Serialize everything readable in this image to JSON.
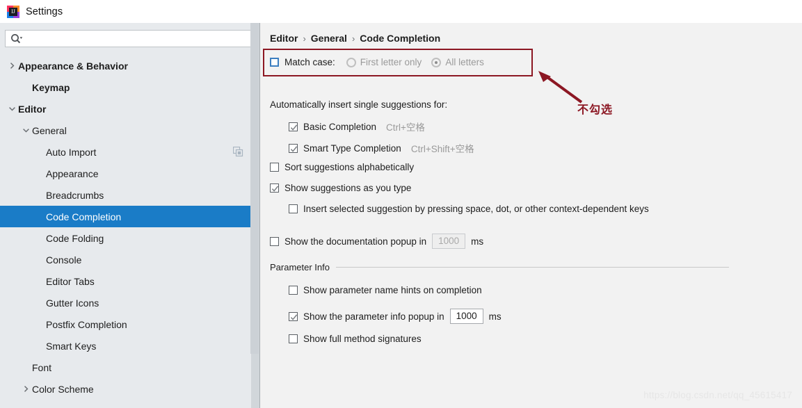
{
  "window": {
    "title": "Settings",
    "app_icon": "intellij-idea-icon"
  },
  "sidebar": {
    "search": {
      "placeholder": "",
      "value": "",
      "icon": "search-icon"
    },
    "items": [
      {
        "label": "Appearance & Behavior",
        "indent": 0,
        "arrow": "collapsed",
        "bold": true,
        "selected": false,
        "extra_icon": ""
      },
      {
        "label": "Keymap",
        "indent": 1,
        "arrow": "none",
        "bold": true,
        "selected": false,
        "extra_icon": ""
      },
      {
        "label": "Editor",
        "indent": 0,
        "arrow": "expanded",
        "bold": true,
        "selected": false,
        "extra_icon": ""
      },
      {
        "label": "General",
        "indent": 1,
        "arrow": "expanded",
        "bold": false,
        "selected": false,
        "extra_icon": ""
      },
      {
        "label": "Auto Import",
        "indent": 2,
        "arrow": "none",
        "bold": false,
        "selected": false,
        "extra_icon": "copy-icon"
      },
      {
        "label": "Appearance",
        "indent": 2,
        "arrow": "none",
        "bold": false,
        "selected": false,
        "extra_icon": ""
      },
      {
        "label": "Breadcrumbs",
        "indent": 2,
        "arrow": "none",
        "bold": false,
        "selected": false,
        "extra_icon": ""
      },
      {
        "label": "Code Completion",
        "indent": 2,
        "arrow": "none",
        "bold": false,
        "selected": true,
        "extra_icon": ""
      },
      {
        "label": "Code Folding",
        "indent": 2,
        "arrow": "none",
        "bold": false,
        "selected": false,
        "extra_icon": ""
      },
      {
        "label": "Console",
        "indent": 2,
        "arrow": "none",
        "bold": false,
        "selected": false,
        "extra_icon": ""
      },
      {
        "label": "Editor Tabs",
        "indent": 2,
        "arrow": "none",
        "bold": false,
        "selected": false,
        "extra_icon": ""
      },
      {
        "label": "Gutter Icons",
        "indent": 2,
        "arrow": "none",
        "bold": false,
        "selected": false,
        "extra_icon": ""
      },
      {
        "label": "Postfix Completion",
        "indent": 2,
        "arrow": "none",
        "bold": false,
        "selected": false,
        "extra_icon": ""
      },
      {
        "label": "Smart Keys",
        "indent": 2,
        "arrow": "none",
        "bold": false,
        "selected": false,
        "extra_icon": ""
      },
      {
        "label": "Font",
        "indent": 1,
        "arrow": "none",
        "bold": false,
        "selected": false,
        "extra_icon": ""
      },
      {
        "label": "Color Scheme",
        "indent": 1,
        "arrow": "collapsed",
        "bold": false,
        "selected": false,
        "extra_icon": ""
      }
    ]
  },
  "breadcrumb": {
    "separator": "›",
    "items": [
      "Editor",
      "General",
      "Code Completion"
    ]
  },
  "settings": {
    "match_case": {
      "label": "Match case:",
      "checked": false,
      "options": [
        {
          "label": "First letter only",
          "selected": false,
          "disabled": true
        },
        {
          "label": "All letters",
          "selected": true,
          "disabled": true
        }
      ]
    },
    "auto_insert_header": "Automatically insert single suggestions for:",
    "basic_completion": {
      "label": "Basic Completion",
      "shortcut": "Ctrl+空格",
      "checked": true
    },
    "smart_type_completion": {
      "label": "Smart Type Completion",
      "shortcut": "Ctrl+Shift+空格",
      "checked": true
    },
    "sort_alphabetically": {
      "label": "Sort suggestions alphabetically",
      "checked": false
    },
    "show_as_you_type": {
      "label": "Show suggestions as you type",
      "checked": true
    },
    "insert_selected": {
      "label": "Insert selected suggestion by pressing space, dot, or other context-dependent keys",
      "checked": false
    },
    "doc_popup": {
      "label": "Show the documentation popup in",
      "checked": false,
      "value": "1000",
      "unit": "ms",
      "disabled": true
    },
    "parameter_info": {
      "group_label": "Parameter Info",
      "name_hints": {
        "label": "Show parameter name hints on completion",
        "checked": false
      },
      "info_popup": {
        "label": "Show the parameter info popup in",
        "checked": true,
        "value": "1000",
        "unit": "ms",
        "disabled": false
      },
      "full_signatures": {
        "label": "Show full method signatures",
        "checked": false
      }
    }
  },
  "annotation": {
    "text": "不勾选",
    "color": "#8c1723"
  },
  "watermark": "https://blog.csdn.net/qq_45615417"
}
